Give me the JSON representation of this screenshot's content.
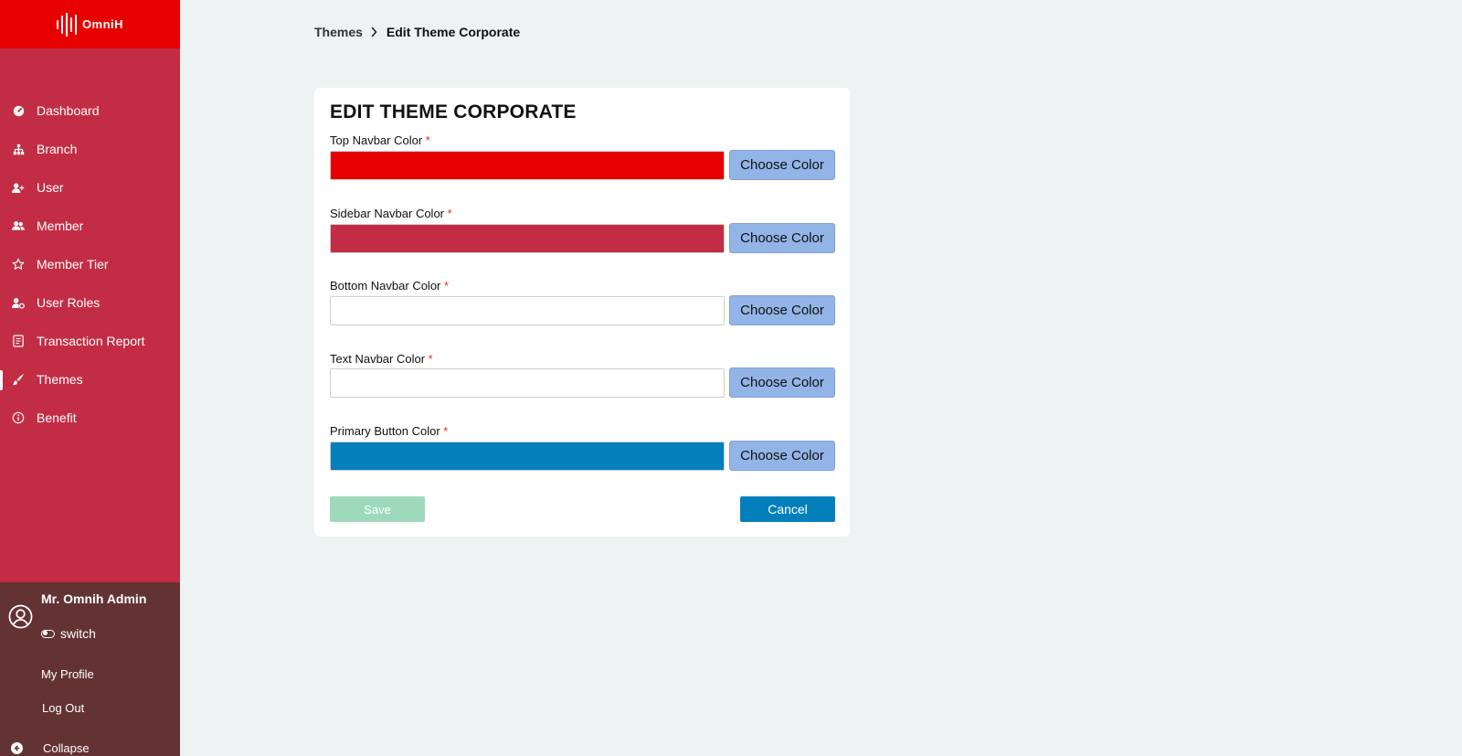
{
  "app": {
    "logo_text": "OmniH"
  },
  "colors": {
    "top_navbar": "#e60000",
    "sidebar": "#c22d45",
    "user_panel": "#633333",
    "primary_button": "#0380bb",
    "choose_button": "#93b4e6",
    "save_disabled": "#9ed9bb"
  },
  "sidebar": {
    "items": [
      {
        "label": "Dashboard",
        "icon": "dashboard-icon",
        "active": false
      },
      {
        "label": "Branch",
        "icon": "hierarchy-icon",
        "active": false
      },
      {
        "label": "User",
        "icon": "user-add-icon",
        "active": false
      },
      {
        "label": "Member",
        "icon": "users-icon",
        "active": false
      },
      {
        "label": "Member Tier",
        "icon": "star-icon",
        "active": false
      },
      {
        "label": "User Roles",
        "icon": "user-gear-icon",
        "active": false
      },
      {
        "label": "Transaction Report",
        "icon": "report-icon",
        "active": false
      },
      {
        "label": "Themes",
        "icon": "brush-icon",
        "active": true
      },
      {
        "label": "Benefit",
        "icon": "info-icon",
        "active": false
      }
    ],
    "user": {
      "name": "Mr. Omnih Admin",
      "switch_label": "switch",
      "profile_link": "My Profile",
      "logout_link": "Log Out",
      "collapse_label": "Collapse"
    }
  },
  "breadcrumb": {
    "parent": "Themes",
    "current": "Edit Theme Corporate"
  },
  "form": {
    "title": "EDIT THEME CORPORATE",
    "required_mark": "*",
    "fields": [
      {
        "label": "Top Navbar Color",
        "value": "#e60000",
        "button": "Choose Color"
      },
      {
        "label": "Sidebar Navbar Color",
        "value": "#c22d45",
        "button": "Choose Color"
      },
      {
        "label": "Bottom Navbar Color",
        "value": "#ffffff",
        "button": "Choose Color"
      },
      {
        "label": "Text Navbar Color",
        "value": "#ffffff",
        "button": "Choose Color"
      },
      {
        "label": "Primary Button Color",
        "value": "#0380bb",
        "button": "Choose Color"
      }
    ],
    "save_label": "Save",
    "cancel_label": "Cancel"
  }
}
